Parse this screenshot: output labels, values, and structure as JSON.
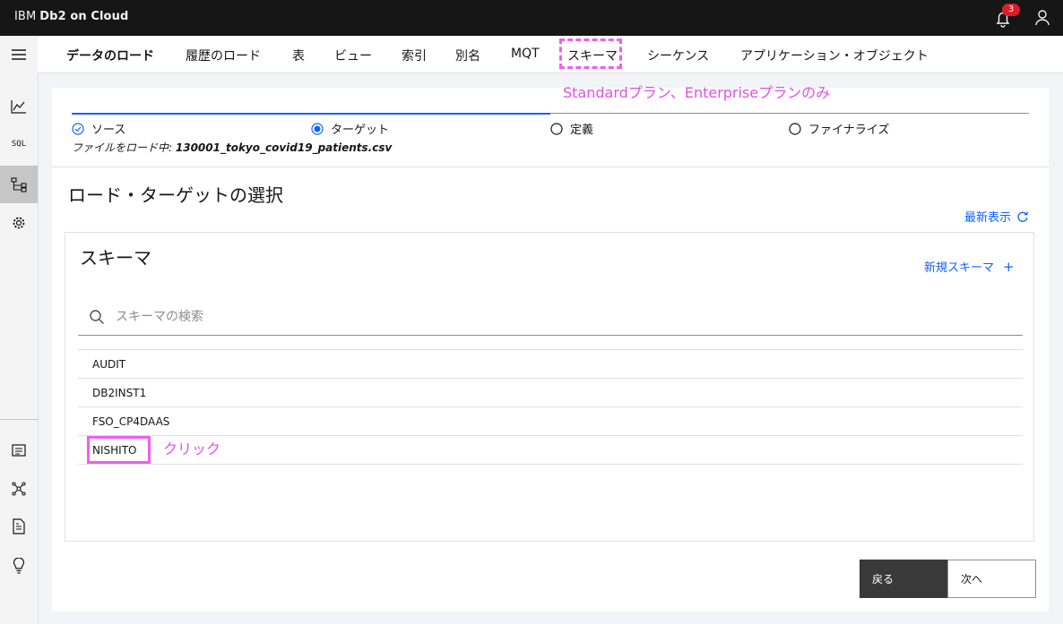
{
  "app": {
    "brand_prefix": "IBM",
    "brand_name": "Db2 on Cloud",
    "notification_count": "3"
  },
  "sidebar": {
    "items": [
      {
        "icon": "menu-icon"
      },
      {
        "icon": "monitor-chart-icon"
      },
      {
        "icon": "sql-icon",
        "label": "SQL"
      },
      {
        "icon": "data-tree-icon",
        "active": true
      },
      {
        "icon": "settings-icon"
      },
      {
        "icon": "list-icon"
      },
      {
        "icon": "network-icon"
      },
      {
        "icon": "document-icon"
      },
      {
        "icon": "lightbulb-icon"
      }
    ]
  },
  "tabs": [
    {
      "label": "データのロード",
      "active": true
    },
    {
      "label": "履歴のロード"
    },
    {
      "label": "表"
    },
    {
      "label": "ビュー"
    },
    {
      "label": "索引"
    },
    {
      "label": "別名"
    },
    {
      "label": "MQT"
    },
    {
      "label": "スキーマ"
    },
    {
      "label": "シーケンス"
    },
    {
      "label": "アプリケーション・オブジェクト"
    }
  ],
  "annotations": {
    "plan_note": "Standardプラン、Enterpriseプランのみ",
    "click_note": "クリック",
    "color": "#ee5ef0"
  },
  "progress": {
    "steps": [
      {
        "label": "ソース",
        "state": "complete"
      },
      {
        "label": "ターゲット",
        "state": "current"
      },
      {
        "label": "定義",
        "state": "incomplete"
      },
      {
        "label": "ファイナライズ",
        "state": "incomplete"
      }
    ],
    "file_prefix": "ファイルをロード中:",
    "file_name": "130001_tokyo_covid19_patients.csv"
  },
  "page": {
    "title": "ロード・ターゲットの選択",
    "refresh_label": "最新表示"
  },
  "schema_panel": {
    "title": "スキーマ",
    "new_schema_label": "新規スキーマ",
    "search_placeholder": "スキーマの検索",
    "items": [
      "AUDIT",
      "DB2INST1",
      "FSO_CP4DAAS",
      "NISHITO"
    ]
  },
  "buttons": {
    "back_label": "戻る",
    "next_label": "次へ"
  }
}
